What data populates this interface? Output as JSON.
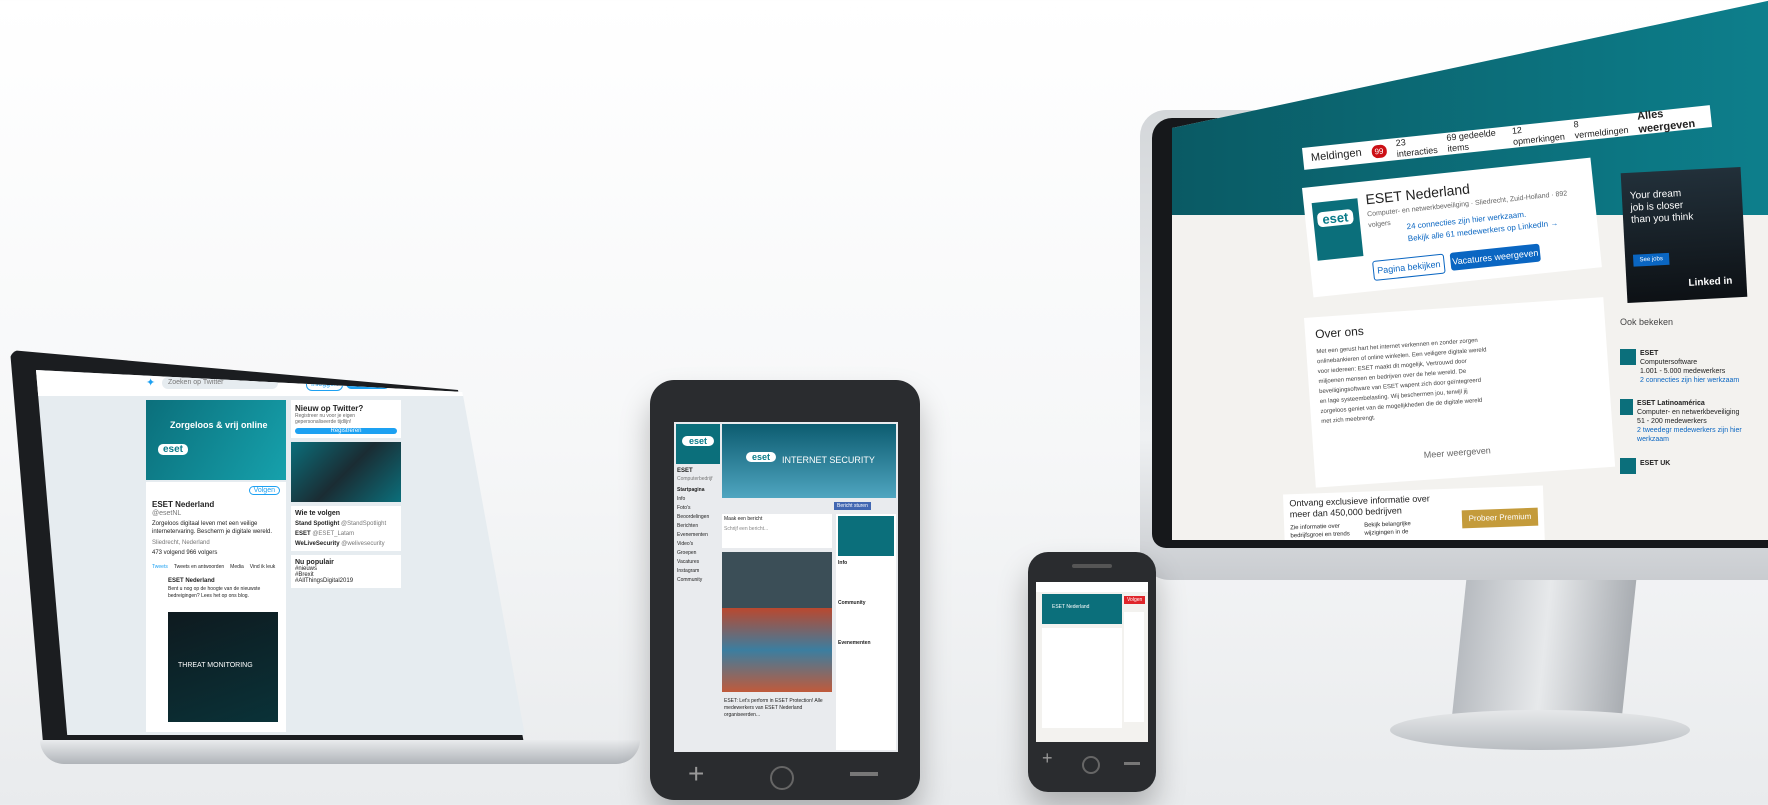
{
  "linkedin": {
    "toolbar": {
      "notifications": "Meldingen",
      "notif_count": "99",
      "stats": [
        "23 interacties",
        "69 gedeelde items",
        "12 opmerkingen",
        "8 vermeldingen"
      ],
      "show_all": "Alles weergeven"
    },
    "company": {
      "name": "ESET Nederland",
      "meta": "Computer- en netwerkbeveiliging · Sliedrecht, Zuid-Holland · 892 volgers",
      "connections": "24 connecties zijn hier werkzaam.",
      "see_all": "Bekijk alle 61 medewerkers op LinkedIn →",
      "btn_view": "Pagina bekijken",
      "btn_jobs": "Vacatures weergeven"
    },
    "about": {
      "title": "Over ons",
      "text": "Met een gerust hart het internet verkennen en zonder zorgen onlinebankieren of online winkelen. Een veiligere digitale wereld voor iedereen: ESET maakt dit mogelijk, Vertrouwd door miljoenen mensen en bedrijven over de hele wereld. De beveiligingsoftware van ESET wapent zich door geïntegreerd en lage systeembelasting. Wij beschermen jou, terwijl jij zorgeloos geniet van de mogelijkheden die de digitale wereld met zich meebrengt.",
      "more": "Meer weergeven"
    },
    "premium": {
      "title": "Ontvang exclusieve informatie over meer dan 450,000 bedrijven",
      "item1": "Zie informatie over bedrijfsgroei en trends",
      "item2": "Bekijk belangrijke wijzigingen in de",
      "button": "Probeer Premium gratis"
    },
    "ad": {
      "text": "Your dream job is closer than you think",
      "button": "See jobs",
      "brand": "Linked in"
    },
    "also_viewed": {
      "title": "Ook bekeken",
      "items": [
        {
          "name": "ESET",
          "line1": "Computersoftware",
          "line2": "1.001 - 5.000 medewerkers",
          "line3": "2 connecties zijn hier werkzaam"
        },
        {
          "name": "ESET Latinoamérica",
          "line1": "Computer- en netwerkbeveiliging",
          "line2": "51 - 200 medewerkers",
          "line3": "2 tweedegr medewerkers zijn hier werkzaam"
        },
        {
          "name": "ESET UK",
          "line1": "",
          "line2": "",
          "line3": ""
        }
      ]
    }
  },
  "twitter": {
    "search_placeholder": "Zoeken op Twitter",
    "login": "Inloggen",
    "signup": "Registreren",
    "banner": "Zorgeloos & vrij online",
    "profile_name": "ESET Nederland",
    "handle": "@esetNL",
    "follow": "Volgen",
    "bio": "Zorgeloos digitaal leven met een veilige internetervaring. Bescherm je digitale wereld.",
    "location": "Sliedrecht, Nederland",
    "counts": "473 volgend  966 volgers",
    "tabs": [
      "Tweets",
      "Tweets en antwoorden",
      "Media",
      "Vind ik leuk"
    ],
    "tweet_author": "ESET Nederland",
    "tweet_text": "Bent u nog op de hoogte van de nieuwste bedreigingen? Lees het op ons blog.",
    "media_title": "THREAT MONITORING",
    "new_title": "Nieuw op Twitter?",
    "new_sub": "Registreer nu voor je eigen gepersonaliseerde tijdlijn!",
    "new_button": "Registreren",
    "who_to_follow": "Wie te volgen",
    "who": [
      {
        "name": "Stand Spotlight",
        "handle": "@StandSpotlight"
      },
      {
        "name": "ESET",
        "handle": "@ESET_Latam"
      },
      {
        "name": "WeLiveSecurity",
        "handle": "@welivesecurity"
      }
    ],
    "trends_title": "Nu populair",
    "trends": [
      "#nieuws",
      "#Brexit",
      "#AllThingsDigital2019"
    ]
  },
  "facebook": {
    "page_name": "ESET",
    "page_sub": "Computerbedrijf",
    "nav": [
      "Startpagina",
      "Info",
      "Foto's",
      "Beoordelingen",
      "Berichten",
      "Evenementen",
      "Video's",
      "Groepen",
      "Vacatures",
      "Instagram",
      "Community"
    ],
    "cover_title": "INTERNET SECURITY",
    "post_composer": "Maak een bericht",
    "post_placeholder": "Schrijf een bericht...",
    "events": "Evenementen",
    "send_message": "Bericht sturen",
    "community": "Community",
    "info": "Info",
    "post_text": "ESET: Let's perform in ESET Protection! Alle medewerkers van ESET Nederland organiseerden..."
  },
  "phone": {
    "brand": "ESET Nederland",
    "button": "Volgen"
  },
  "colors": {
    "teal": "#0b6f7b",
    "linkedin_blue": "#0a66c2",
    "twitter_blue": "#1da1f2",
    "premium_gold": "#c49b3b"
  }
}
